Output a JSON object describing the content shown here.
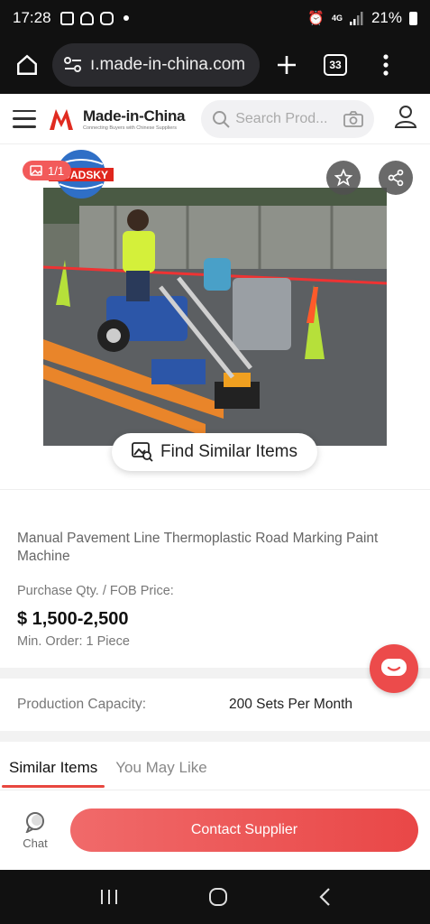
{
  "status_bar": {
    "time": "17:28",
    "network": "4G",
    "battery": "21%"
  },
  "browser": {
    "url": "ı.made-in-china.com",
    "tab_count": "33"
  },
  "site": {
    "logo_title": "Made-in-China",
    "logo_subtitle": "Connecting Buyers with Chinese Suppliers",
    "search_placeholder": "Search Prod..."
  },
  "gallery": {
    "image_counter": "1/1",
    "brand_overlay": "ROADSKY",
    "find_similar_label": "Find Similar Items"
  },
  "product": {
    "title": "Manual Pavement Line Thermoplastic Road Marking Paint Machine",
    "qty_price_label": "Purchase Qty. / FOB Price:",
    "price": "$ 1,500-2,500",
    "min_order": "Min. Order: 1 Piece"
  },
  "capacity": {
    "label": "Production Capacity:",
    "value": "200 Sets Per Month"
  },
  "tabs": [
    {
      "label": "Similar Items",
      "active": true
    },
    {
      "label": "You May Like",
      "active": false
    }
  ],
  "actions": {
    "chat_label": "Chat",
    "contact_label": "Contact Supplier"
  },
  "colors": {
    "accent": "#e94747",
    "dark_bar": "#111111"
  }
}
